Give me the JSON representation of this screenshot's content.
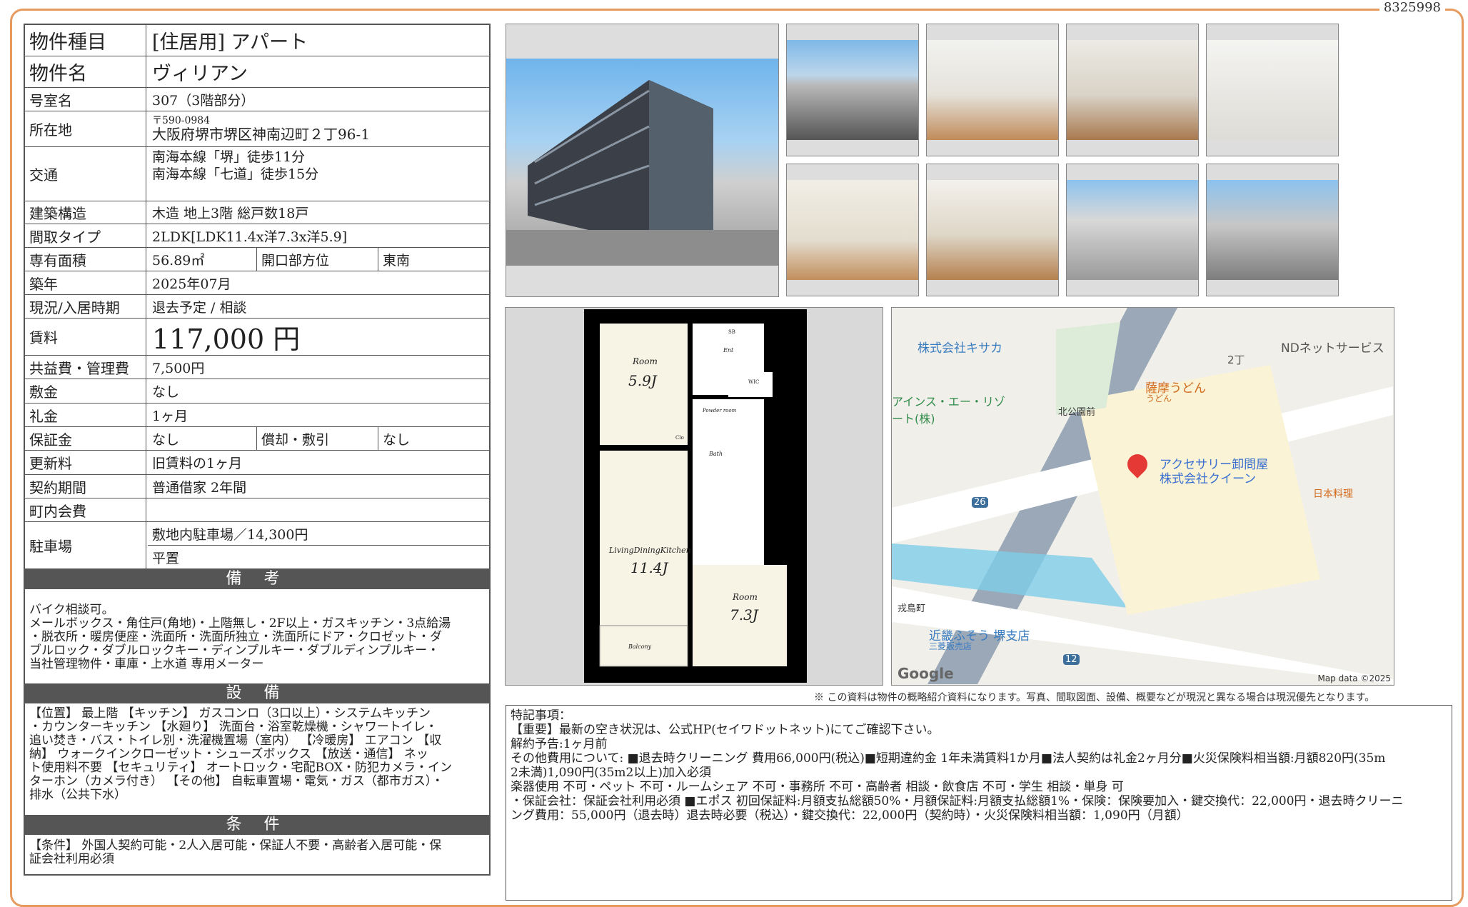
{
  "doc_id": "8325998",
  "table": {
    "type_label": "物件種目",
    "type_value": "[住居用] アパート",
    "name_label": "物件名",
    "name_value": "ヴィリアン",
    "room_label": "号室名",
    "room_value": "307（3階部分）",
    "address_label": "所在地",
    "address_zip": "〒590-0984",
    "address_value": "大阪府堺市堺区神南辺町２丁96-1",
    "transport_label": "交通",
    "transport_1": "南海本線「堺」徒歩11分",
    "transport_2": "南海本線「七道」徒歩15分",
    "structure_label": "建築構造",
    "structure_value": "木造 地上3階 総戸数18戸",
    "layout_label": "間取タイプ",
    "layout_value": "2LDK[LDK11.4x洋7.3x洋5.9]",
    "area_label": "専有面積",
    "area_value": "56.89㎡",
    "direction_label": "開口部方位",
    "direction_value": "東南",
    "built_label": "築年",
    "built_value": "2025年07月",
    "status_label": "現況/入居時期",
    "status_value": "退去予定 / 相談",
    "rent_label": "賃料",
    "rent_value": "117,000 円",
    "fee_label": "共益費・管理費",
    "fee_value": "7,500円",
    "deposit_label": "敷金",
    "deposit_value": "なし",
    "keymoney_label": "礼金",
    "keymoney_value": "1ヶ月",
    "guarantee_label": "保証金",
    "guarantee_value": "なし",
    "amort_label": "償却・敷引",
    "amort_value": "なし",
    "renewal_label": "更新料",
    "renewal_value": "旧賃料の1ヶ月",
    "contract_label": "契約期間",
    "contract_value": "普通借家 2年間",
    "town_label": "町内会費",
    "town_value": "",
    "parking_label": "駐車場",
    "parking_1": "敷地内駐車場／14,300円",
    "parking_2": "平置"
  },
  "sections": {
    "remarks_title": "備 考",
    "remarks_text": "バイク相談可。\nメールボックス・角住戸(角地)・上階無し・2F以上・ガスキッチン・3点給湯\n・脱衣所・暖房便座・洗面所・洗面所独立・洗面所にドア・クロゼット・ダ\nブルロック・ダブルロックキー・ディンプルキー・ダブルディンプルキー・\n当社管理物件・車庫・上水道 専用メーター",
    "equipment_title": "設 備",
    "equipment_text": "【位置】 最上階 【キッチン】 ガスコンロ（3口以上）・システムキッチン\n・カウンターキッチン 【水廻り】 洗面台・浴室乾燥機・シャワートイレ・\n追い焚き・バス・トイレ別・洗濯機置場（室内） 【冷暖房】 エアコン 【収\n納】 ウォークインクローゼット・シューズボックス 【放送・通信】 ネッ\nト使用料不要 【セキュリティ】 オートロック・宅配BOX・防犯カメラ・イン\nターホン（カメラ付き） 【その他】 自転車置場・電気・ガス（都市ガス）・\n排水（公共下水）",
    "conditions_title": "条 件",
    "conditions_text": "【条件】 外国人契約可能・2人入居可能・保証人不要・高齢者入居可能・保\n証会社利用必須"
  },
  "floorplan": {
    "room1": "Room",
    "room1_size": "5.9J",
    "ldk": "LivingDiningKitchen",
    "ldk_size": "11.4J",
    "room2": "Room",
    "room2_size": "7.3J",
    "balcony": "Balcony",
    "entrance": "Ent",
    "bath": "Bath",
    "powder": "Powder room",
    "wc": "WIC",
    "clo": "Clo",
    "sb": "SB"
  },
  "map": {
    "labels": [
      "株式会社キサカ",
      "NDネットサービス",
      "薩摩うどん",
      "うどん",
      "アインス・エー・リゾート(株)",
      "北公園前",
      "アクセサリー卸問屋",
      "株式会社クイーン",
      "日本料理",
      "戎島町",
      "近畿ふそう 堺支店",
      "三菱販売店",
      "2丁",
      "26",
      "12"
    ],
    "google": "Google",
    "mapdata": "Map data ©2025"
  },
  "notice": "※ この資料は物件の概略紹介資料になります。写真、間取図面、設備、概要などが現況と異なる場合は現況優先となります。",
  "notes_text": "特記事項：\n【重要】最新の空き状況は、公式HP(セイワドットネット)にてご確認下さい。\n解約予告:1ヶ月前\nその他費用について: ■退去時クリーニング 費用66,000円(税込)■短期違約金 1年未満賃料1か月■法人契約は礼金2ヶ月分■火災保険料相当額:月額820円(35m\n2未満)1,090円(35m2以上)加入必須\n楽器使用 不可・ペット 不可・ルームシェア 不可・事務所 不可・高齢者 相談・飲食店 不可・学生 相談・単身 可\n・保証会社：保証会社利用必須 ■エポス 初回保証料:月額支払総額50%・月額保証料:月額支払総額1%・保険：保険要加入・鍵交換代：22,000円・退去時クリーニ\nング費用：55,000円（退去時）退去時必要（税込）・鍵交換代：22,000円（契約時）・火災保険料相当額：1,090円（月額）"
}
